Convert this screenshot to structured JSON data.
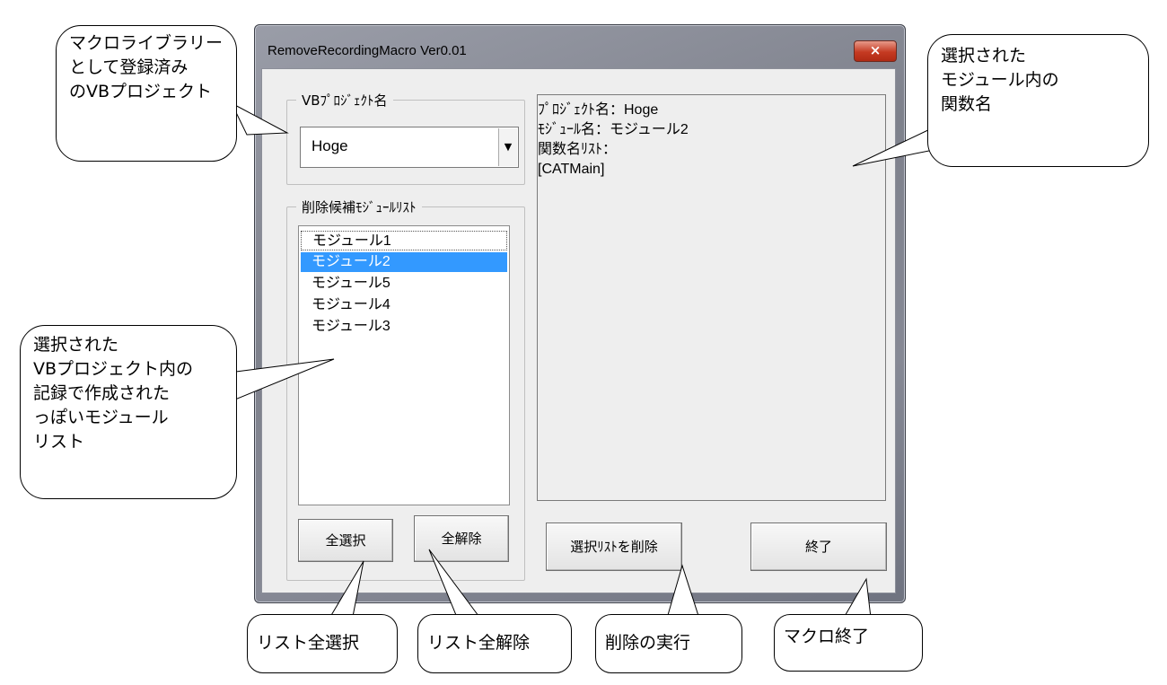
{
  "window": {
    "title": "RemoveRecordingMacro Ver0.01",
    "close_symbol": "×"
  },
  "vb_project_group": {
    "label": "VBﾌﾟﾛｼﾞｪｸﾄ名",
    "selected": "Hoge",
    "dropdown_arrow": "▼"
  },
  "module_group": {
    "label": "削除候補ﾓｼﾞｭｰﾙﾘｽﾄ",
    "items": [
      "モジュール1",
      "モジュール2",
      "モジュール5",
      "モジュール4",
      "モジュール3"
    ],
    "selected_index": 1
  },
  "info_box": {
    "lines": [
      "ﾌﾟﾛｼﾞｪｸﾄ名：Hoge",
      "ﾓｼﾞｭｰﾙ名：モジュール2",
      "関数名ﾘｽﾄ：",
      "[CATMain]"
    ]
  },
  "buttons": {
    "select_all": "全選択",
    "deselect_all": "全解除",
    "delete_selected": "選択ﾘｽﾄを削除",
    "exit": "終了"
  },
  "callouts": {
    "library": [
      "マクロライブラリー",
      "として登録済み",
      "のVBプロジェクト"
    ],
    "functions": [
      "選択された",
      "モジュール内の",
      "関数名"
    ],
    "module_list": [
      "選択された",
      "VBプロジェクト内の",
      "記録で作成された",
      "っぽいモジュール",
      "リスト"
    ],
    "select_all": "リスト全選択",
    "deselect_all": "リスト全解除",
    "delete": "削除の実行",
    "exit": "マクロ終了"
  },
  "colors": {
    "selection": "#3399ff",
    "close_button": "#c53a22"
  }
}
